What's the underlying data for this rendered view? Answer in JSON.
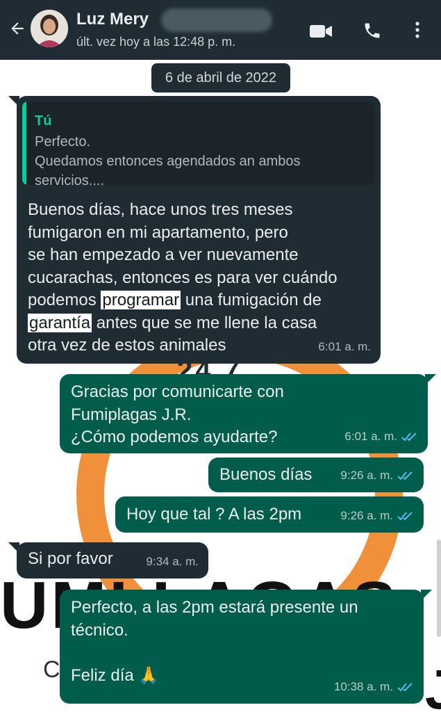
{
  "header": {
    "contact_name": "Luz Mery",
    "last_seen": "últ. vez hoy a las 12:48 p. m."
  },
  "chat": {
    "date_chip": "6 de abril de 2022",
    "background_text": {
      "number": "24 7",
      "brand": "UMI  LAGAS",
      "c": "C",
      "j": "J"
    },
    "messages": [
      {
        "direction": "in",
        "quote_author": "Tú",
        "quote_text": "Perfecto.\nQuedamos entonces agendados an ambos\nservicios....",
        "text_pre1": "Buenos días, hace unos tres meses\nfumigaron en mi apartamento, pero\nse han empezado a ver nuevamente\ncucarachas, entonces es para ver cuándo\npodemos ",
        "hl1": "programar",
        "text_mid": " una fumigación de\n",
        "hl2": "garantía",
        "text_post": " antes que se me llene la casa\notra vez de estos animales",
        "time": "6:01 a. m."
      },
      {
        "direction": "out",
        "text": "Gracias por comunicarte con\nFumiplagas J.R.\n¿Cómo podemos ayudarte?",
        "time": "6:01 a. m."
      },
      {
        "direction": "out",
        "text": "Buenos días",
        "time": "9:26 a. m."
      },
      {
        "direction": "out",
        "text": "Hoy que tal ? A las 2pm",
        "time": "9:26 a. m."
      },
      {
        "direction": "in",
        "text": "Si por favor",
        "time": "9:34 a. m."
      },
      {
        "direction": "out",
        "text": "Perfecto, a las 2pm estará presente un\ntécnico.\n\nFeliz día 🙏",
        "time": "10:38 a. m."
      }
    ]
  },
  "colors": {
    "header_bg": "#1f2c34",
    "incoming_bubble": "#202c33",
    "outgoing_bubble": "#005c4b",
    "read_ticks": "#53bdeb",
    "brand_orange": "#ef8a2f"
  },
  "icons": [
    "back-arrow-icon",
    "video-call-icon",
    "phone-icon",
    "more-options-icon",
    "read-receipt-icon"
  ]
}
